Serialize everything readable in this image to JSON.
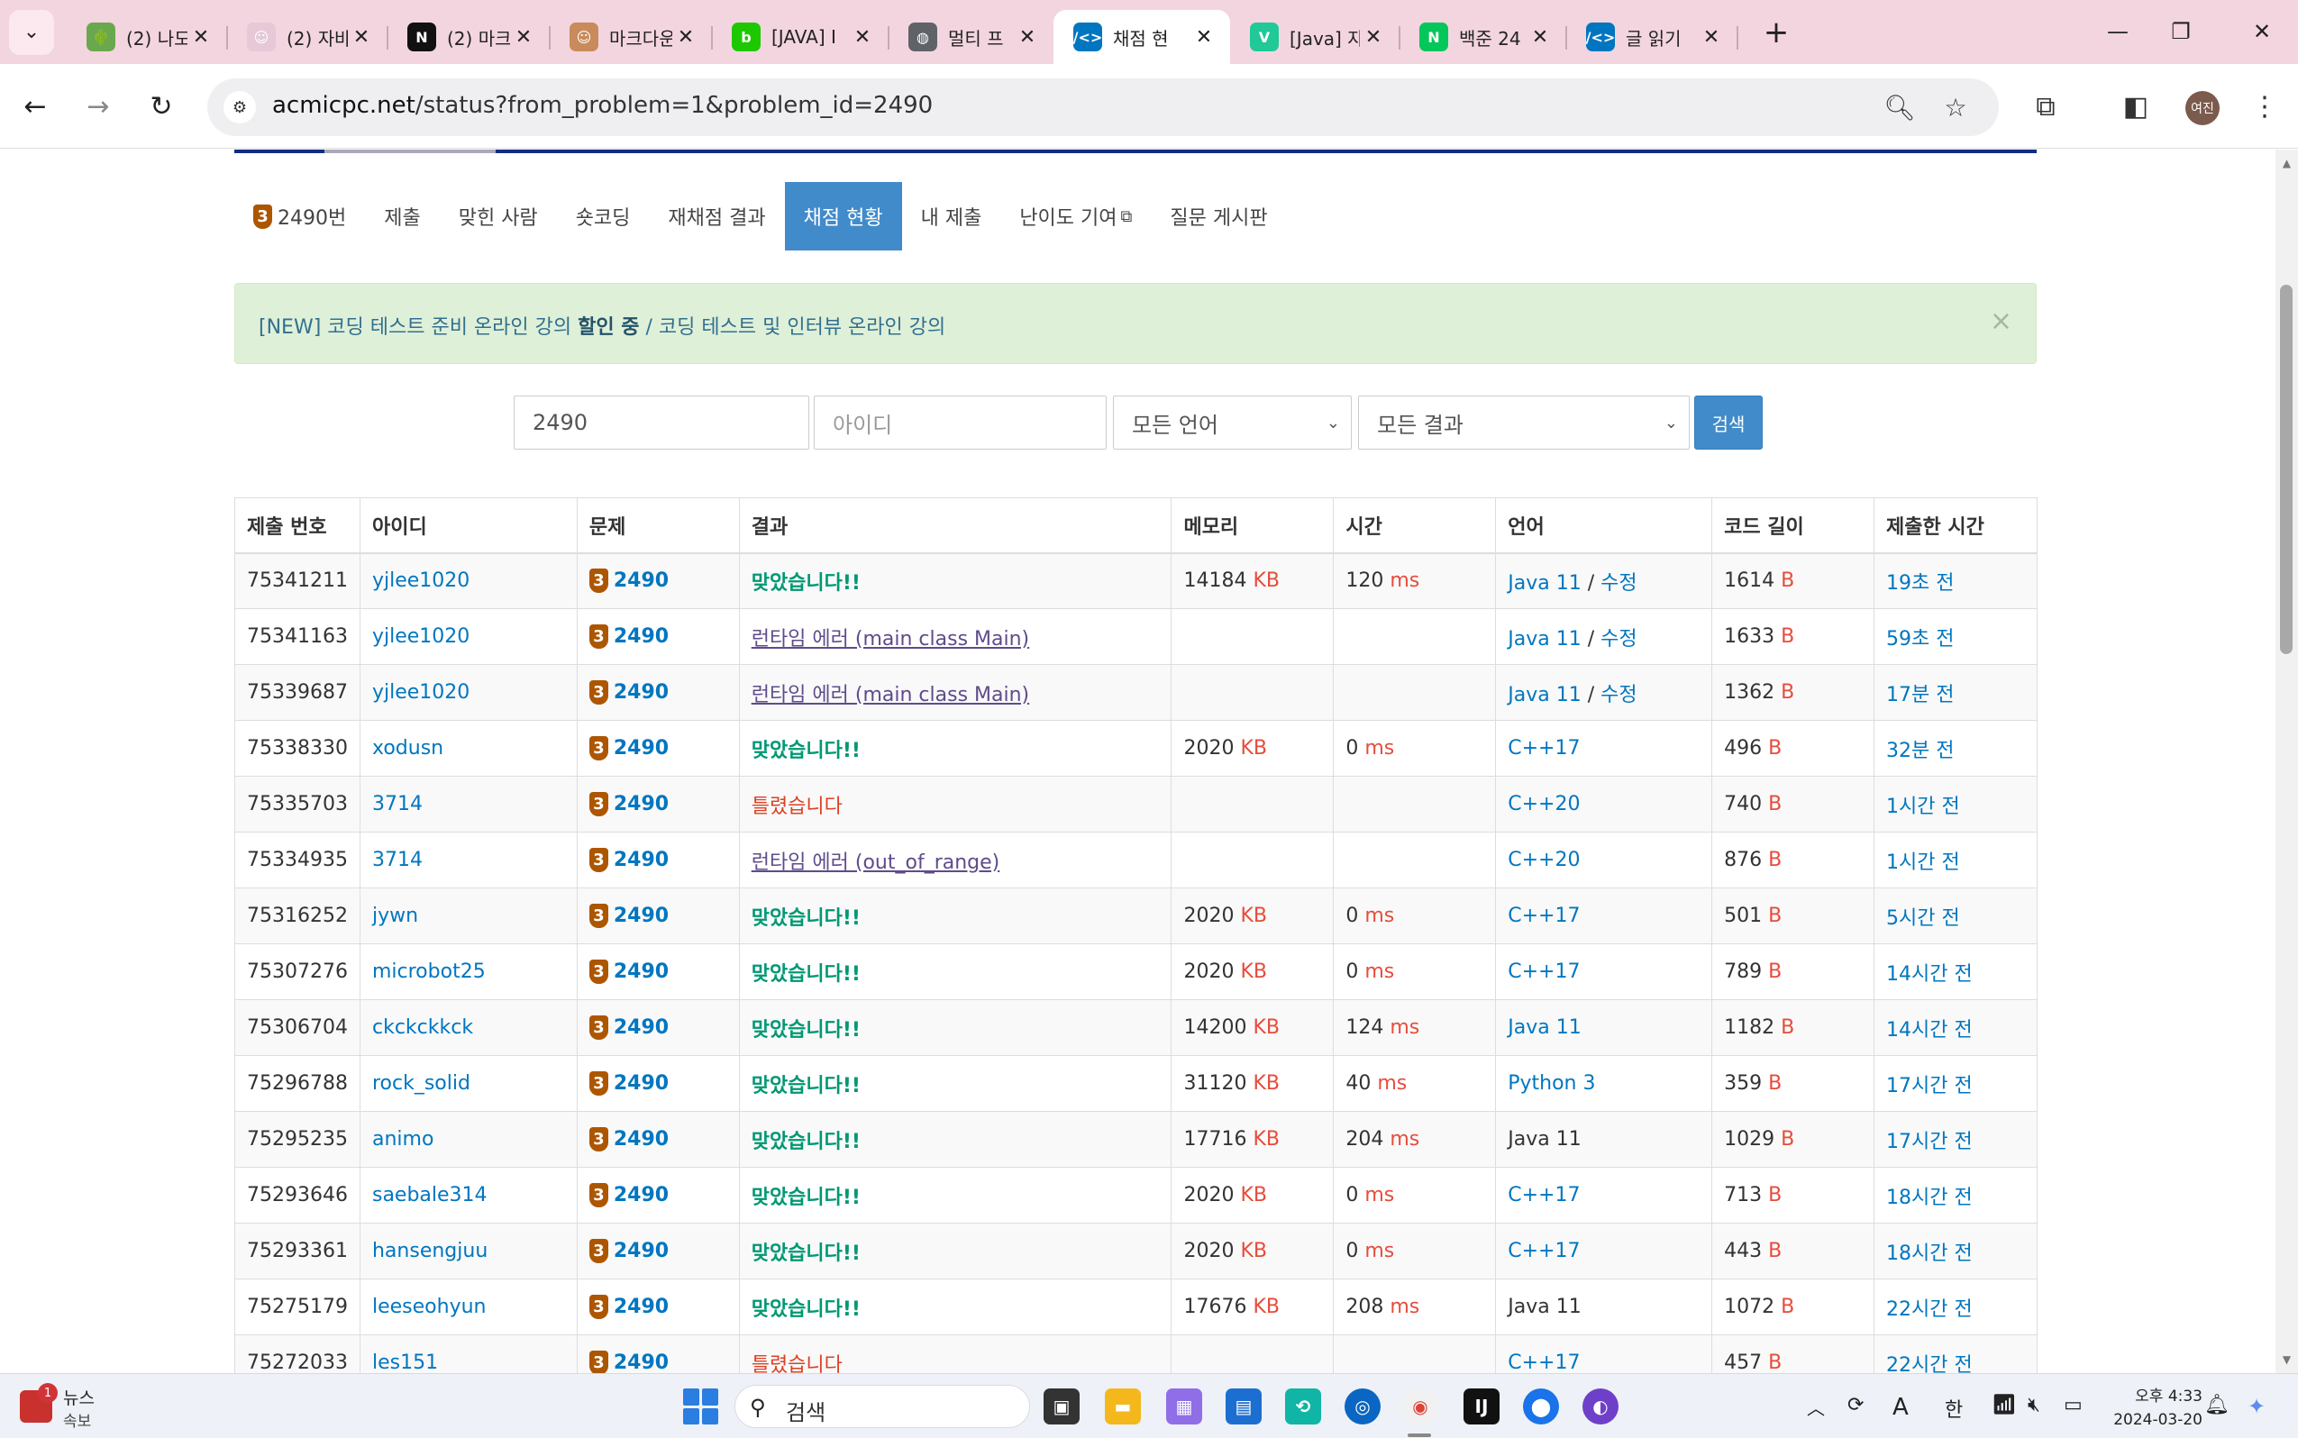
{
  "browser": {
    "tabs": [
      {
        "title": "(2) 나도",
        "icon": "cactus-favicon",
        "icon_color": "#6aa84f",
        "glyph": "🌵",
        "active": false
      },
      {
        "title": "(2) 자바",
        "icon": "avatar-favicon",
        "icon_color": "#e6c8d6",
        "glyph": "☺",
        "active": false
      },
      {
        "title": "(2) 마크",
        "icon": "notion-favicon",
        "icon_color": "#111111",
        "glyph": "N",
        "active": false
      },
      {
        "title": "마크다운",
        "icon": "avatar-favicon",
        "icon_color": "#c98b5b",
        "glyph": "☺",
        "active": false
      },
      {
        "title": "[JAVA] I",
        "icon": "blog-favicon",
        "icon_color": "#1ec800",
        "glyph": "b",
        "active": false
      },
      {
        "title": "멀티 프",
        "icon": "globe-favicon",
        "icon_color": "#5f6368",
        "glyph": "◍",
        "active": false
      },
      {
        "title": "채점 현",
        "icon": "code-favicon",
        "icon_color": "#0076c0",
        "glyph": "/<>",
        "active": true
      },
      {
        "title": "[Java] 자",
        "icon": "velog-favicon",
        "icon_color": "#20c997",
        "glyph": "V",
        "active": false
      },
      {
        "title": "백준 24",
        "icon": "naver-favicon",
        "icon_color": "#03c75a",
        "glyph": "N",
        "active": false
      },
      {
        "title": "글 읽기",
        "icon": "code-favicon",
        "icon_color": "#0076c0",
        "glyph": "/<>",
        "active": false
      }
    ],
    "url_host": "acmicpc.net",
    "url_path": "/status?from_problem=1&problem_id=2490",
    "avatar_text": "여진"
  },
  "subnav": {
    "problem": "2490번",
    "items": [
      "제출",
      "맞힌 사람",
      "숏코딩",
      "재채점 결과",
      "채점 현황",
      "내 제출",
      "난이도 기여",
      "질문 게시판"
    ],
    "active_index": 4,
    "tier": "3"
  },
  "alert": {
    "prefix": "[NEW] 코딩 테스트 준비 온라인 강의 ",
    "bold": "할인 중",
    "suffix": " / 코딩 테스트 및 인터뷰 온라인 강의",
    "close": "×"
  },
  "search": {
    "problem_value": "2490",
    "user_placeholder": "아이디",
    "language": "모든 언어",
    "result": "모든 결과",
    "button": "검색"
  },
  "table": {
    "headers": [
      "제출 번호",
      "아이디",
      "문제",
      "결과",
      "메모리",
      "시간",
      "언어",
      "코드 길이",
      "제출한 시간"
    ],
    "rows": [
      {
        "id": "75341211",
        "user": "yjlee1020",
        "problem": "2490",
        "result": "맞았습니다!!",
        "status": "ac",
        "memory": "14184",
        "time": "120",
        "lang": "Java 11",
        "edit": "수정",
        "lang_link": true,
        "length": "1614",
        "when": "19초 전"
      },
      {
        "id": "75341163",
        "user": "yjlee1020",
        "problem": "2490",
        "result": "런타임 에러 (main class Main)",
        "status": "re",
        "memory": "",
        "time": "",
        "lang": "Java 11",
        "edit": "수정",
        "lang_link": true,
        "length": "1633",
        "when": "59초 전"
      },
      {
        "id": "75339687",
        "user": "yjlee1020",
        "problem": "2490",
        "result": "런타임 에러 (main class Main)",
        "status": "re",
        "memory": "",
        "time": "",
        "lang": "Java 11",
        "edit": "수정",
        "lang_link": true,
        "length": "1362",
        "when": "17분 전"
      },
      {
        "id": "75338330",
        "user": "xodusn",
        "problem": "2490",
        "result": "맞았습니다!!",
        "status": "ac",
        "memory": "2020",
        "time": "0",
        "lang": "C++17",
        "edit": "",
        "lang_link": true,
        "length": "496",
        "when": "32분 전"
      },
      {
        "id": "75335703",
        "user": "3714",
        "problem": "2490",
        "result": "틀렸습니다",
        "status": "wa",
        "memory": "",
        "time": "",
        "lang": "C++20",
        "edit": "",
        "lang_link": true,
        "length": "740",
        "when": "1시간 전"
      },
      {
        "id": "75334935",
        "user": "3714",
        "problem": "2490",
        "result": "런타임 에러 (out_of_range)",
        "status": "re",
        "memory": "",
        "time": "",
        "lang": "C++20",
        "edit": "",
        "lang_link": true,
        "length": "876",
        "when": "1시간 전"
      },
      {
        "id": "75316252",
        "user": "jywn",
        "problem": "2490",
        "result": "맞았습니다!!",
        "status": "ac",
        "memory": "2020",
        "time": "0",
        "lang": "C++17",
        "edit": "",
        "lang_link": true,
        "length": "501",
        "when": "5시간 전"
      },
      {
        "id": "75307276",
        "user": "microbot25",
        "problem": "2490",
        "result": "맞았습니다!!",
        "status": "ac",
        "memory": "2020",
        "time": "0",
        "lang": "C++17",
        "edit": "",
        "lang_link": true,
        "length": "789",
        "when": "14시간 전"
      },
      {
        "id": "75306704",
        "user": "ckckckkck",
        "problem": "2490",
        "result": "맞았습니다!!",
        "status": "ac",
        "memory": "14200",
        "time": "124",
        "lang": "Java 11",
        "edit": "",
        "lang_link": true,
        "length": "1182",
        "when": "14시간 전"
      },
      {
        "id": "75296788",
        "user": "rock_solid",
        "problem": "2490",
        "result": "맞았습니다!!",
        "status": "ac",
        "memory": "31120",
        "time": "40",
        "lang": "Python 3",
        "edit": "",
        "lang_link": true,
        "length": "359",
        "when": "17시간 전"
      },
      {
        "id": "75295235",
        "user": "animo",
        "problem": "2490",
        "result": "맞았습니다!!",
        "status": "ac",
        "memory": "17716",
        "time": "204",
        "lang": "Java 11",
        "edit": "",
        "lang_link": false,
        "length": "1029",
        "when": "17시간 전"
      },
      {
        "id": "75293646",
        "user": "saebale314",
        "problem": "2490",
        "result": "맞았습니다!!",
        "status": "ac",
        "memory": "2020",
        "time": "0",
        "lang": "C++17",
        "edit": "",
        "lang_link": true,
        "length": "713",
        "when": "18시간 전"
      },
      {
        "id": "75293361",
        "user": "hansengjuu",
        "problem": "2490",
        "result": "맞았습니다!!",
        "status": "ac",
        "memory": "2020",
        "time": "0",
        "lang": "C++17",
        "edit": "",
        "lang_link": true,
        "length": "443",
        "when": "18시간 전"
      },
      {
        "id": "75275179",
        "user": "leeseohyun",
        "problem": "2490",
        "result": "맞았습니다!!",
        "status": "ac",
        "memory": "17676",
        "time": "208",
        "lang": "Java 11",
        "edit": "",
        "lang_link": false,
        "length": "1072",
        "when": "22시간 전"
      },
      {
        "id": "75272033",
        "user": "les151",
        "problem": "2490",
        "result": "틀렸습니다",
        "status": "wa",
        "memory": "",
        "time": "",
        "lang": "C++17",
        "edit": "",
        "lang_link": true,
        "length": "457",
        "when": "22시간 전"
      }
    ],
    "units": {
      "memory": "KB",
      "time": "ms",
      "length": "B"
    }
  },
  "taskbar": {
    "news_title": "뉴스",
    "news_sub": "속보",
    "news_badge": "1",
    "search_placeholder": "검색",
    "ime_a": "A",
    "ime_han": "한",
    "time": "오후 4:33",
    "date": "2024-03-20"
  },
  "colors": {
    "accent": "#428bca",
    "link": "#0076c0",
    "accepted": "#009874",
    "wrong": "#dd4124",
    "runtime": "#5f4b8b",
    "unit": "#e74c3c",
    "tier_bronze": "#ad5600"
  }
}
